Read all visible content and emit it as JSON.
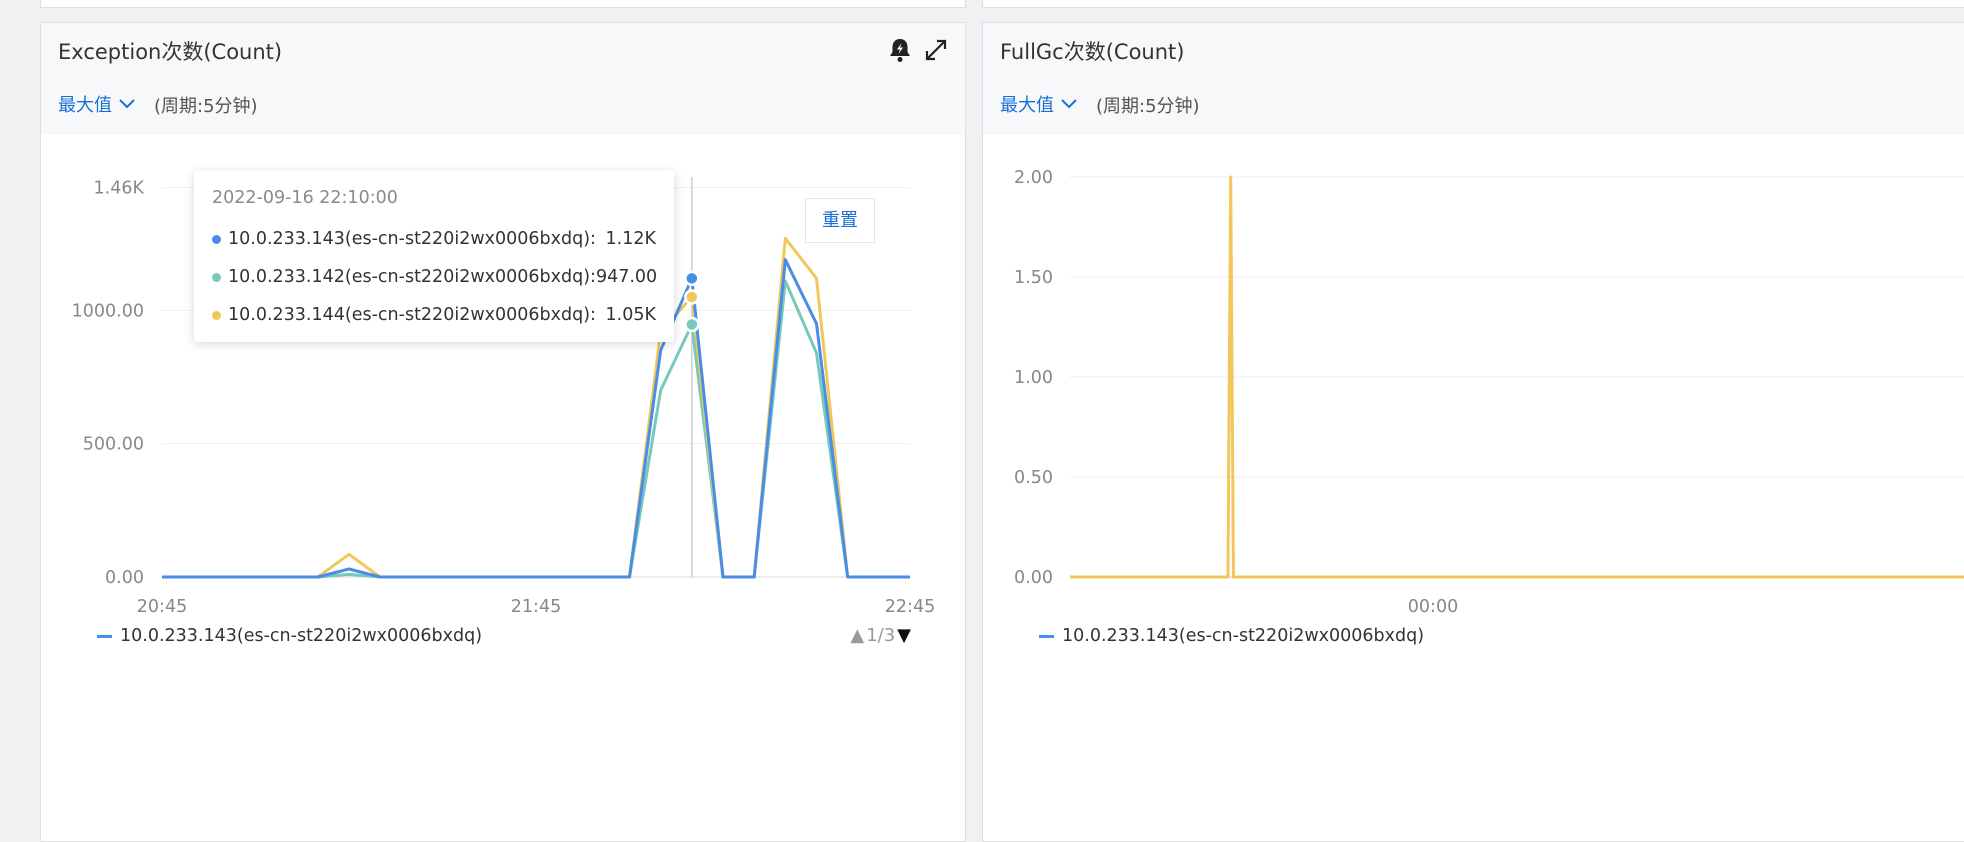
{
  "colors": {
    "series_blue": "#4a8de6",
    "series_teal": "#77c9bb",
    "series_yellow": "#f1c75b",
    "link_blue": "#1a6fd6"
  },
  "panels": [
    {
      "title": "Exception次数(Count)",
      "stat_select": "最大值",
      "period": "(周期:5分钟)",
      "icons": [
        "bell-lightning-icon",
        "expand-icon"
      ],
      "legend_label": "10.0.233.143(es-cn-st220i2wx0006bxdq)",
      "pager": "1/3",
      "reset_label": "重置",
      "tooltip": {
        "time": "2022-09-16 22:10:00",
        "rows": [
          {
            "name": "10.0.233.143(es-cn-st220i2wx0006bxdq):",
            "value": "1.12K",
            "color": "#4a8de6"
          },
          {
            "name": "10.0.233.142(es-cn-st220i2wx0006bxdq):",
            "value": "947.00",
            "color": "#77c9bb"
          },
          {
            "name": "10.0.233.144(es-cn-st220i2wx0006bxdq):",
            "value": "1.05K",
            "color": "#f1c75b"
          }
        ]
      }
    },
    {
      "title": "FullGc次数(Count)",
      "stat_select": "最大值",
      "period": "(周期:5分钟)",
      "legend_label": "10.0.233.143(es-cn-st220i2wx0006bxdq)"
    }
  ],
  "chart_data": [
    {
      "type": "line",
      "title": "Exception次数(Count)",
      "xlabel": "",
      "ylabel": "",
      "x_tick_labels": [
        "20:45",
        "21:45",
        "22:45"
      ],
      "y_tick_labels": [
        "0.00",
        "500.00",
        "1000.00",
        "1.46K"
      ],
      "y_ticks": [
        0,
        500,
        1000,
        1460
      ],
      "ylim": [
        0,
        1500
      ],
      "x_minutes": [
        0,
        5,
        10,
        15,
        20,
        25,
        30,
        35,
        40,
        45,
        50,
        55,
        60,
        65,
        70,
        75,
        80,
        85,
        90,
        95,
        100,
        105,
        110,
        115,
        120
      ],
      "x_start_label": "20:45",
      "x_end_minutes": 120,
      "highlight_x_minutes": 85,
      "grid": true,
      "legend": "bottom-left",
      "series": [
        {
          "name": "10.0.233.143(es-cn-st220i2wx0006bxdq)",
          "color": "#4a8de6",
          "values": [
            0,
            0,
            0,
            0,
            0,
            0,
            30,
            0,
            0,
            0,
            0,
            0,
            0,
            0,
            0,
            0,
            0,
            0,
            0,
            0,
            0,
            0,
            0,
            0,
            0
          ]
        },
        {
          "name": "10.0.233.142(es-cn-st220i2wx0006bxdq)",
          "color": "#77c9bb",
          "values": [
            0,
            0,
            0,
            0,
            0,
            0,
            10,
            0,
            0,
            0,
            0,
            0,
            0,
            0,
            0,
            0,
            0,
            0,
            0,
            0,
            0,
            0,
            0,
            0,
            0
          ]
        },
        {
          "name": "10.0.233.144(es-cn-st220i2wx0006bxdq)",
          "color": "#f1c75b",
          "values": [
            0,
            0,
            0,
            0,
            0,
            0,
            85,
            0,
            0,
            0,
            0,
            0,
            0,
            0,
            0,
            0,
            0,
            0,
            0,
            0,
            0,
            0,
            0,
            0,
            0
          ]
        }
      ],
      "series_tail": [
        {
          "x": [
            75,
            80,
            85,
            90,
            95,
            100,
            105,
            110,
            115,
            120
          ],
          "values": [
            0,
            850,
            1120,
            0,
            0,
            1190,
            950,
            0,
            0,
            0
          ]
        },
        {
          "x": [
            75,
            80,
            85,
            90,
            95,
            100,
            105,
            110,
            115,
            120
          ],
          "values": [
            0,
            700,
            947,
            0,
            0,
            1110,
            840,
            0,
            0,
            0
          ]
        },
        {
          "x": [
            75,
            80,
            85,
            90,
            95,
            100,
            105,
            110,
            115,
            120
          ],
          "values": [
            0,
            920,
            1050,
            0,
            0,
            1270,
            1120,
            0,
            0,
            0
          ]
        }
      ]
    },
    {
      "type": "line",
      "title": "FullGc次数(Count)",
      "xlabel": "",
      "ylabel": "",
      "x_tick_labels": [
        "00:00"
      ],
      "y_tick_labels": [
        "0.00",
        "0.50",
        "1.00",
        "1.50",
        "2.00"
      ],
      "y_ticks": [
        0,
        0.5,
        1,
        1.5,
        2
      ],
      "ylim": [
        0,
        2
      ],
      "grid": true,
      "legend": "bottom-left",
      "series": [
        {
          "name": "10.0.233.143(es-cn-st220i2wx0006bxdq)",
          "color": "#f1c75b",
          "x_fraction": [
            0,
            0.173,
            0.176,
            0.179,
            1
          ],
          "values": [
            0,
            0,
            2,
            0,
            0
          ]
        }
      ]
    }
  ]
}
